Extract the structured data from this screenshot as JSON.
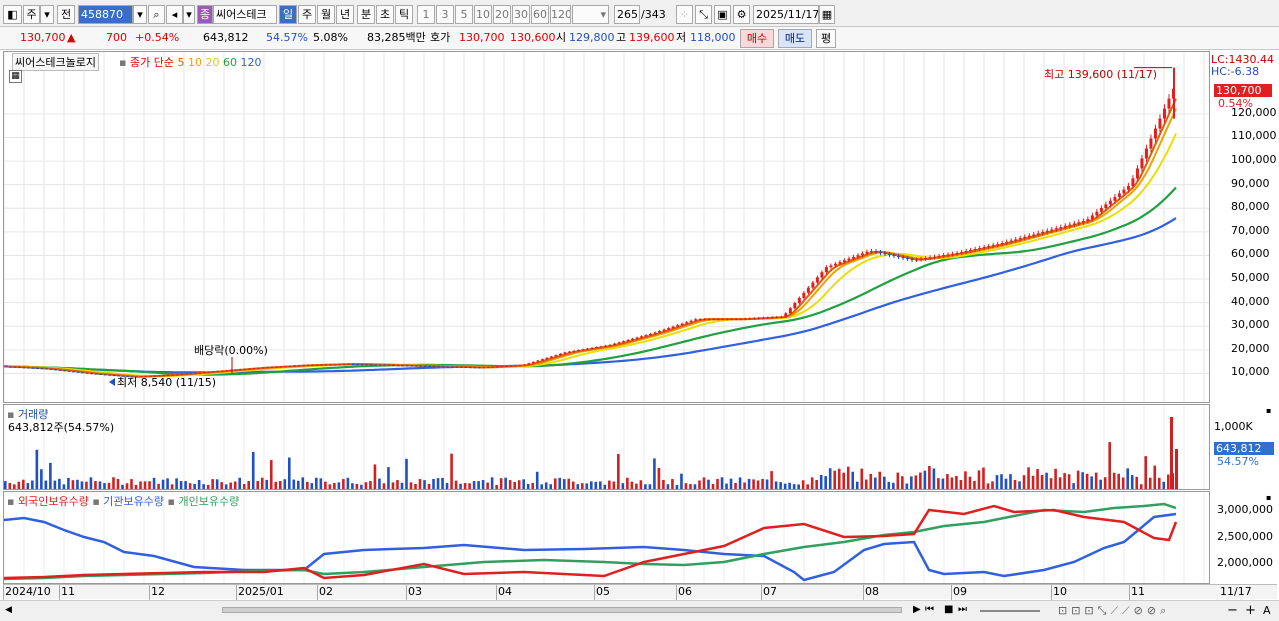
{
  "toolbar": {
    "code_prefix": "주",
    "prev_label": "전",
    "code": "458870",
    "badge": "종",
    "name": "씨어스테크",
    "periods": [
      "일",
      "주",
      "월",
      "년",
      "분",
      "초",
      "틱"
    ],
    "nums": [
      "1",
      "3",
      "5",
      "10",
      "20",
      "30",
      "60",
      "120"
    ],
    "count": "265",
    "total": "/343",
    "date": "2025/11/17"
  },
  "quote": {
    "price": "130,700",
    "arrow": "▲",
    "change": "700",
    "change_pct": "+0.54%",
    "volume": "643,812",
    "vol_ratio": "54.57%",
    "turnover": "5.08%",
    "amount": "83,285백만",
    "ask_label": "호가",
    "ask": "130,700",
    "bid": "130,600",
    "open_label": "시",
    "open": "129,800",
    "high_label": "고",
    "high": "139,600",
    "low_label": "저",
    "low": "118,000",
    "buy": "매수",
    "sell": "매도",
    "eval": "평"
  },
  "chart_data": [
    {
      "type": "candlestick",
      "title": "씨어스테크놀로지",
      "legend": [
        "종가 단순",
        "5",
        "10",
        "20",
        "60",
        "120"
      ],
      "series_colors": {
        "close": "#e00000",
        "5": "#e06000",
        "10": "#f0a000",
        "20": "#e8e000",
        "60": "#20a040",
        "120": "#3060e0"
      },
      "x": [
        "2024/10",
        "11",
        "12",
        "2025/01",
        "02",
        "03",
        "04",
        "05",
        "06",
        "07",
        "08",
        "09",
        "10",
        "11"
      ],
      "yticks": [
        10000,
        20000,
        30000,
        40000,
        50000,
        60000,
        70000,
        80000,
        90000,
        100000,
        110000,
        120000
      ],
      "ylim": [
        0,
        142000
      ],
      "close": [
        13000,
        12000,
        10000,
        8540,
        9500,
        11000,
        12500,
        13500,
        14000,
        13500,
        13000,
        12500,
        13500,
        19000,
        22000,
        27000,
        33000,
        33000,
        34000,
        55000,
        62000,
        58000,
        61000,
        65000,
        70000,
        75000,
        90000,
        130700
      ],
      "annotations": [
        "최고 139,600 (11/17)",
        "최저 8,540 (11/15)",
        "배당락(0.00%)"
      ],
      "scale_labels": {
        "lc": "LC:1430.44",
        "hc": "HC:-6.38",
        "price": "130,700",
        "pct": "0.54%"
      }
    },
    {
      "type": "bar",
      "title": "거래량",
      "subtitle": "643,812주(54.57%)",
      "yticks": [
        "1,000K"
      ],
      "current": "643,812",
      "current_pct": "54.57%"
    },
    {
      "type": "line",
      "series": [
        {
          "name": "외국인보유수량",
          "color": "#e02020"
        },
        {
          "name": "기관보유수량",
          "color": "#3060e0"
        },
        {
          "name": "개인보유수량",
          "color": "#30a060"
        }
      ],
      "yticks": [
        "3,000,000",
        "2,500,000",
        "2,000,000"
      ]
    }
  ],
  "xaxis": {
    "labels": [
      "2024/10",
      "11",
      "12",
      "2025/01",
      "02",
      "03",
      "04",
      "05",
      "06",
      "07",
      "08",
      "09",
      "10",
      "11"
    ],
    "last": "11/17"
  }
}
